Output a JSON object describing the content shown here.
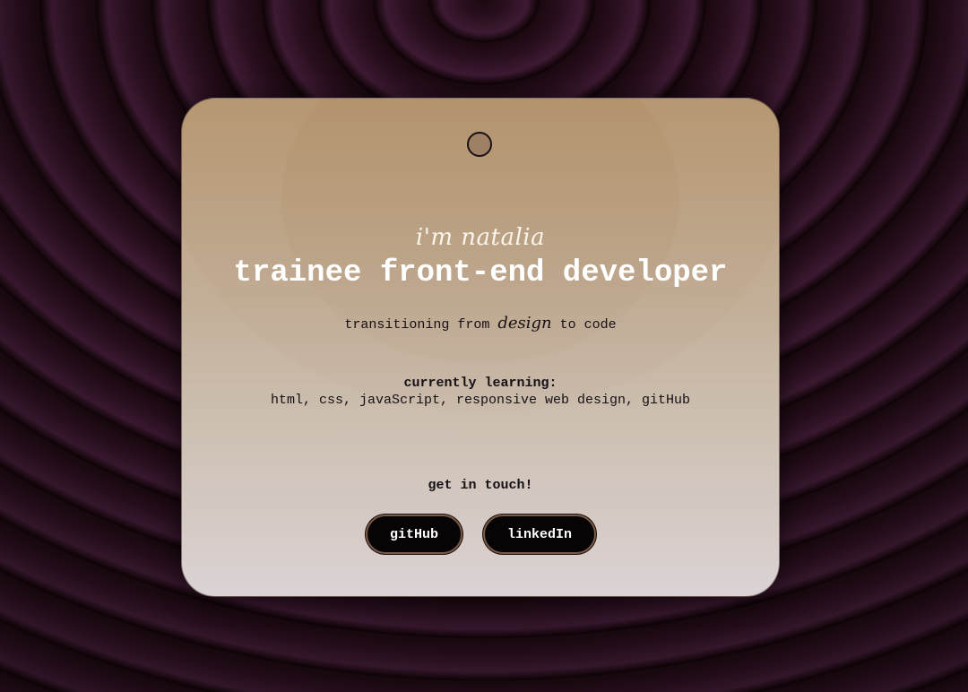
{
  "card": {
    "greeting": "i'm natalia",
    "title": "trainee front-end developer",
    "subtitle_before": "transitioning from ",
    "subtitle_emphasis": "design",
    "subtitle_after": " to code",
    "learning_heading": "currently learning:",
    "learning_list": "html, css, javaScript, responsive web design, gitHub",
    "contact_heading": "get in touch!",
    "buttons": {
      "github_label": "gitHub",
      "linkedin_label": "linkedIn"
    }
  },
  "colors": {
    "background": "#22091a",
    "card_top": "#b3936c",
    "card_bottom": "#d8cfd1",
    "button": "#070405",
    "title_text": "#ffffff"
  },
  "icons": {
    "card_hole": "circle-icon"
  }
}
